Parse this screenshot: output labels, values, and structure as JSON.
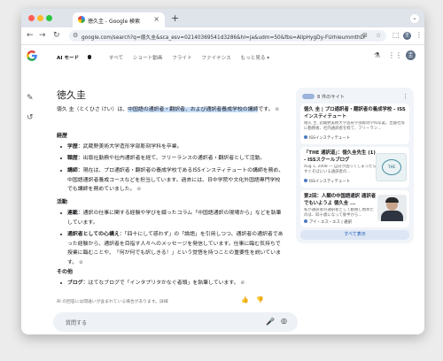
{
  "browser": {
    "tab_title": "徳久圭 - Google 検索",
    "url": "google.com/search?q=徳久圭&sca_esv=02140369541d3286&hl=ja&udm=50&fbs=AllpHygDy-FUrhieummthDfrE...",
    "new_tab": "+"
  },
  "search_nav": {
    "ai_label": "AI モード",
    "ai_badge": "",
    "tabs": [
      "すべて",
      "ショート動画",
      "フライト",
      "ファイナンス",
      "もっと見る ▾"
    ]
  },
  "answer": {
    "title": "徳久圭",
    "intro_plain": "徳久 圭（とくひさ けい）は、",
    "intro_highlight": "中国語の通訳者・翻訳者、および通訳者養成学校の講師",
    "intro_end": "です。",
    "section_career": "経歴",
    "career": [
      {
        "label": "学歴",
        "text": "：武蔵野美術大学造形学部彫刻学科を卒業。"
      },
      {
        "label": "職歴",
        "text": "：出版社勤務や社内通訳者を経て、フリーランスの通訳者・翻訳者として活動。"
      },
      {
        "label": "講師",
        "text": "：現在は、プロ通訳者・翻訳者の養成学校であるISSインスティテュートの講師を務め、中国語通訳者養成コースなどを担当しています。過去には、日中学院や文化外国語専門学校でも講師を務めていました。"
      }
    ],
    "section_activity": "活動",
    "activity": [
      {
        "label": "連載",
        "text": "：通訳の仕事に関する経験や学びを綴ったコラム「中国語通訳の現場から」などを執筆しています。"
      },
      {
        "label": "通訳者としての心構え",
        "text": "：「四十にして惑わず」の「論語」を引用しつつ、通訳者の通訳者であった経験から、通訳者を目指す人々へのメッセージを発信しています。仕事に臨む気持ちで授業に臨むことや、「何が何でも訳しきる！」という覚悟を持つことの重要性を説いています。"
      }
    ],
    "section_other": "その他",
    "other": [
      {
        "label": "ブログ",
        "text": "：はてなブログで「インタプリタかなぐ者頭」を執筆しています。"
      }
    ],
    "disclaimer": "AI の回答には間違いが含まれている場合があります。詳細",
    "ask_placeholder": "質問する"
  },
  "sources": {
    "header": "8 件のサイト",
    "cards": [
      {
        "title": "徳久 圭 | プロ通訳者・翻訳者の養成学校 - ISSインスティテュート",
        "snippet": "徳久 圭. 武蔵野美術大学造形学部彫刻学科卒業。出版社等に勤務後、社内通訳者を経て、フリーラン...",
        "source": "ISSインスティテュート"
      },
      {
        "title": "「THE 通訳道」：徳久圭先生 (1) - ISSスクールブログ",
        "snippet": "Aug 1, 2008 — 自分が困ってしまったらすぐそばにいる通訳者の...",
        "source": "ISSインスティテュート"
      },
      {
        "title": "第2回：人類の中国語通訳 通訳者でもいようよ 徳久圭 ...",
        "snippet": "私が通訳者の通訳者として勤務し始めたのは、四十歳になって後半から...",
        "source": "アイ・エス・エス | 通訳"
      }
    ],
    "more_label": "すべて表示"
  }
}
